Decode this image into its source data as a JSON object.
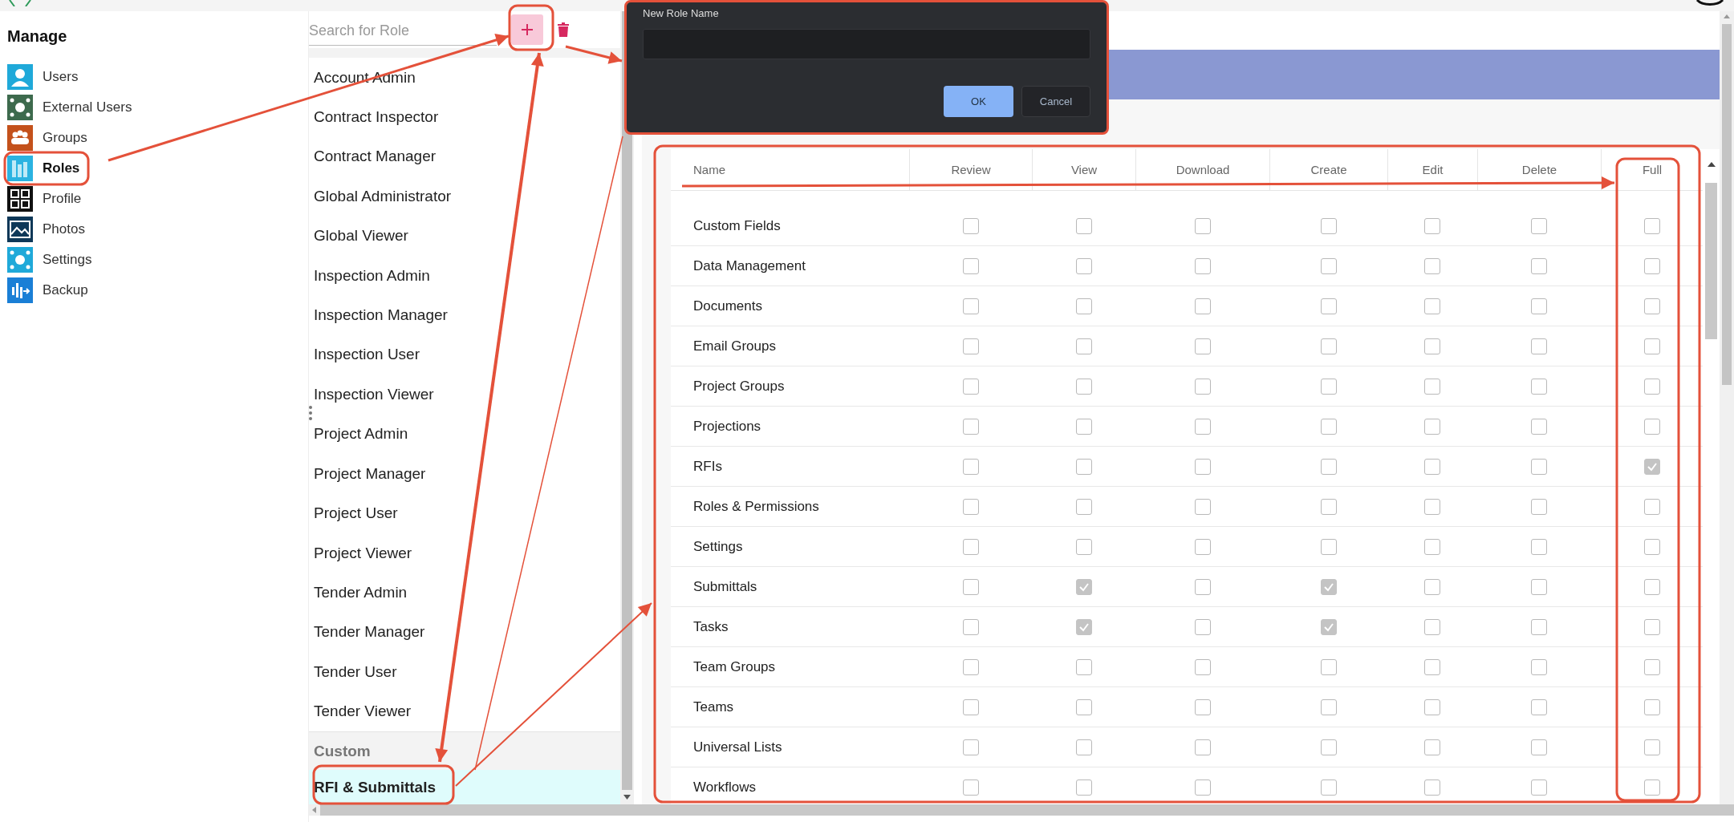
{
  "sidebar": {
    "title": "Manage",
    "items": [
      {
        "label": "Users",
        "selected": false
      },
      {
        "label": "External Users",
        "selected": false
      },
      {
        "label": "Groups",
        "selected": false
      },
      {
        "label": "Roles",
        "selected": true
      },
      {
        "label": "Profile",
        "selected": false
      },
      {
        "label": "Photos",
        "selected": false
      },
      {
        "label": "Settings",
        "selected": false
      },
      {
        "label": "Backup",
        "selected": false
      }
    ]
  },
  "roles_panel": {
    "search": {
      "placeholder": "Search for Role"
    },
    "roles": [
      {
        "label": "Account Admin",
        "selected": false
      },
      {
        "label": "Contract Inspector",
        "selected": false
      },
      {
        "label": "Contract Manager",
        "selected": false
      },
      {
        "label": "Global Administrator",
        "selected": false
      },
      {
        "label": "Global Viewer",
        "selected": false
      },
      {
        "label": "Inspection Admin",
        "selected": false
      },
      {
        "label": "Inspection Manager",
        "selected": false
      },
      {
        "label": "Inspection User",
        "selected": false
      },
      {
        "label": "Inspection Viewer",
        "selected": false
      },
      {
        "label": "Project Admin",
        "selected": false
      },
      {
        "label": "Project Manager",
        "selected": false
      },
      {
        "label": "Project User",
        "selected": false
      },
      {
        "label": "Project Viewer",
        "selected": false
      },
      {
        "label": "Tender Admin",
        "selected": false
      },
      {
        "label": "Tender Manager",
        "selected": false
      },
      {
        "label": "Tender User",
        "selected": false
      },
      {
        "label": "Tender Viewer",
        "selected": false
      }
    ],
    "custom_heading": "Custom",
    "custom_roles": [
      {
        "label": "RFI & Submittals",
        "selected": true
      }
    ]
  },
  "dialog": {
    "title": "New Role Name",
    "buttons": [
      {
        "label": "OK",
        "kind": "primary"
      },
      {
        "label": "Cancel",
        "kind": "secondary"
      }
    ]
  },
  "permissions": {
    "columns": [
      "Name",
      "Review",
      "View",
      "Download",
      "Create",
      "Edit",
      "Delete",
      "Full"
    ],
    "rows": [
      {
        "name": "Custom Fields",
        "checks": [
          false,
          false,
          false,
          false,
          false,
          false,
          false
        ]
      },
      {
        "name": "Data Management",
        "checks": [
          false,
          false,
          false,
          false,
          false,
          false,
          false
        ]
      },
      {
        "name": "Documents",
        "checks": [
          false,
          false,
          false,
          false,
          false,
          false,
          false
        ]
      },
      {
        "name": "Email Groups",
        "checks": [
          false,
          false,
          false,
          false,
          false,
          false,
          false
        ]
      },
      {
        "name": "Project Groups",
        "checks": [
          false,
          false,
          false,
          false,
          false,
          false,
          false
        ]
      },
      {
        "name": "Projections",
        "checks": [
          false,
          false,
          false,
          false,
          false,
          false,
          false
        ]
      },
      {
        "name": "RFIs",
        "checks": [
          false,
          false,
          false,
          false,
          false,
          false,
          true
        ]
      },
      {
        "name": "Roles & Permissions",
        "checks": [
          false,
          false,
          false,
          false,
          false,
          false,
          false
        ]
      },
      {
        "name": "Settings",
        "checks": [
          false,
          false,
          false,
          false,
          false,
          false,
          false
        ]
      },
      {
        "name": "Submittals",
        "checks": [
          false,
          true,
          false,
          true,
          false,
          false,
          false
        ]
      },
      {
        "name": "Tasks",
        "checks": [
          false,
          true,
          false,
          true,
          false,
          false,
          false
        ]
      },
      {
        "name": "Team Groups",
        "checks": [
          false,
          false,
          false,
          false,
          false,
          false,
          false
        ]
      },
      {
        "name": "Teams",
        "checks": [
          false,
          false,
          false,
          false,
          false,
          false,
          false
        ]
      },
      {
        "name": "Universal Lists",
        "checks": [
          false,
          false,
          false,
          false,
          false,
          false,
          false
        ]
      },
      {
        "name": "Workflows",
        "checks": [
          false,
          false,
          false,
          false,
          false,
          false,
          false
        ]
      }
    ]
  }
}
